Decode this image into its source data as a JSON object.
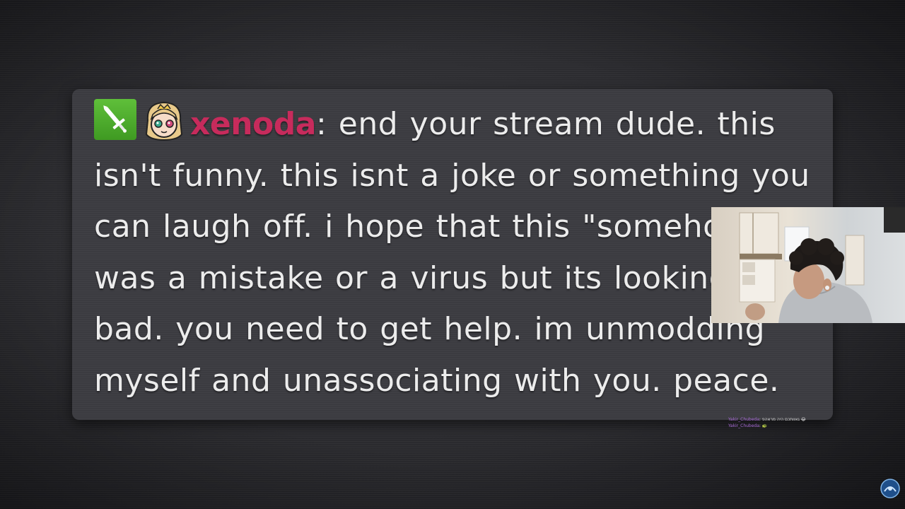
{
  "chat": {
    "username": "xenoda",
    "separator": ":",
    "message": " end your stream dude. this isn't funny. this isnt a joke or something you can laugh off. i hope that this \"somehow\" was a mistake or a virus but its looking real bad. you need to get help. im unmodding myself and unassociating with you. peace.",
    "badge_icon": "moderator-sword-icon",
    "emote_icon": "anime-avatar-emote-icon",
    "username_color": "#c72b5c",
    "badge_color": "#4caf2c"
  },
  "webcam": {
    "icon": "streamer-webcam-feed"
  },
  "overlay_chat": {
    "line1_user": "Yakir_Chubeda",
    "line1_text": ": גאוותכם היה מראהפ 😂",
    "line2_user": "Yakir_Chubeda",
    "line2_text": ": 🐢"
  },
  "corner_logo": {
    "icon": "channel-watermark-logo-icon"
  }
}
